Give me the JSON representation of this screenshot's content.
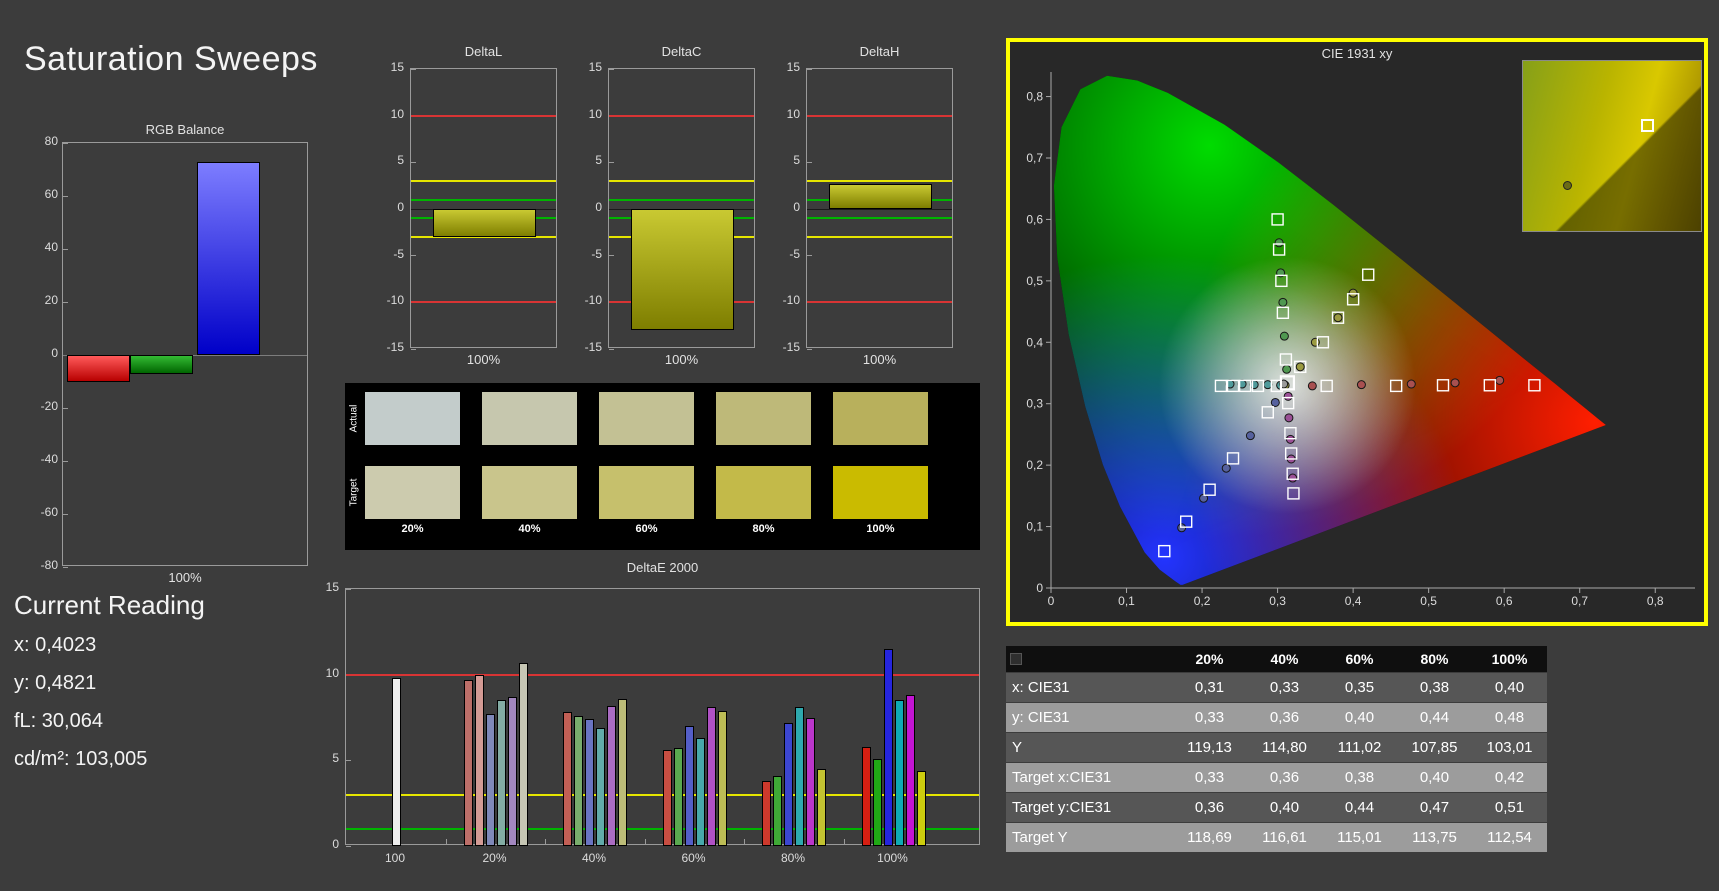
{
  "page": {
    "title": "Saturation Sweeps"
  },
  "current_reading": {
    "heading": "Current Reading",
    "x": "x: 0,4023",
    "y": "y: 0,4821",
    "fl": "fL: 30,064",
    "cdm2": "cd/m²: 103,005"
  },
  "rgb_balance": {
    "title": "RGB Balance",
    "x_label": "100%",
    "ylim": [
      -80,
      80
    ],
    "y_ticks": [
      "80",
      "60",
      "40",
      "20",
      "0",
      "-20",
      "-40",
      "-60",
      "-80"
    ],
    "bars": [
      {
        "name": "red",
        "value": -10,
        "grad": [
          "#ff5a5a",
          "#b80000"
        ]
      },
      {
        "name": "green",
        "value": -7,
        "grad": [
          "#33bb33",
          "#006600"
        ]
      },
      {
        "name": "blue",
        "value": 73,
        "grad": [
          "#7d7dff",
          "#0000c8"
        ]
      }
    ]
  },
  "delta_charts": {
    "ylim": [
      -15,
      15
    ],
    "y_ticks": [
      "15",
      "10",
      "5",
      "0",
      "-5",
      "-10",
      "-15"
    ],
    "bar_grad": [
      "#c9c932",
      "#7e7e00"
    ],
    "limits": [
      {
        "value": 10,
        "color": "#d83434"
      },
      {
        "value": -10,
        "color": "#d83434"
      },
      {
        "value": 3,
        "color": "#e6e600"
      },
      {
        "value": -3,
        "color": "#e6e600"
      },
      {
        "value": 1,
        "color": "#00b400"
      },
      {
        "value": -1,
        "color": "#00b400"
      }
    ],
    "charts": [
      {
        "title": "DeltaL",
        "x_label": "100%",
        "value": -3
      },
      {
        "title": "DeltaC",
        "x_label": "100%",
        "value": -13
      },
      {
        "title": "DeltaH",
        "x_label": "100%",
        "value": 2.7
      }
    ]
  },
  "swatches": {
    "row_labels": [
      "Actual",
      "Target"
    ],
    "col_labels": [
      "20%",
      "40%",
      "60%",
      "80%",
      "100%"
    ],
    "actual": [
      "#c3cccb",
      "#c6c7ae",
      "#c3c194",
      "#beb979",
      "#b8b05c"
    ],
    "target": [
      "#cccbae",
      "#c9c58c",
      "#c6c06c",
      "#c3ba49",
      "#cabb00"
    ]
  },
  "deltae": {
    "title": "DeltaE 2000",
    "ylim": [
      0,
      15
    ],
    "y_ticks": [
      "15",
      "10",
      "5",
      "0"
    ],
    "limits": [
      {
        "value": 10,
        "color": "#d83434"
      },
      {
        "value": 3,
        "color": "#e6e600"
      },
      {
        "value": 1,
        "color": "#00b400"
      }
    ],
    "groups": [
      {
        "label": "100",
        "bars": [
          {
            "v": 9.8,
            "c": "#ededed"
          }
        ]
      },
      {
        "label": "20%",
        "bars": [
          {
            "v": 9.7,
            "c": "#bd6f69"
          },
          {
            "v": 10.0,
            "c": "#d49b95"
          },
          {
            "v": 7.7,
            "c": "#7f88b9"
          },
          {
            "v": 8.5,
            "c": "#83aca4"
          },
          {
            "v": 8.7,
            "c": "#a287bf"
          },
          {
            "v": 10.7,
            "c": "#c6c6b4"
          }
        ]
      },
      {
        "label": "40%",
        "bars": [
          {
            "v": 7.8,
            "c": "#c25f55"
          },
          {
            "v": 7.6,
            "c": "#79ad6d"
          },
          {
            "v": 7.4,
            "c": "#6a74c2"
          },
          {
            "v": 6.9,
            "c": "#62abaa"
          },
          {
            "v": 8.2,
            "c": "#aa6cc2"
          },
          {
            "v": 8.6,
            "c": "#bcbc78"
          }
        ]
      },
      {
        "label": "60%",
        "bars": [
          {
            "v": 5.6,
            "c": "#c84e42"
          },
          {
            "v": 5.7,
            "c": "#5aa950"
          },
          {
            "v": 7.0,
            "c": "#545ec8"
          },
          {
            "v": 6.3,
            "c": "#48a9ab"
          },
          {
            "v": 8.1,
            "c": "#b051c5"
          },
          {
            "v": 7.9,
            "c": "#bcbc55"
          }
        ]
      },
      {
        "label": "80%",
        "bars": [
          {
            "v": 3.8,
            "c": "#cd392c"
          },
          {
            "v": 4.1,
            "c": "#3fa936"
          },
          {
            "v": 7.2,
            "c": "#3c46d0"
          },
          {
            "v": 8.1,
            "c": "#2ea9ae"
          },
          {
            "v": 7.5,
            "c": "#ba36ca"
          },
          {
            "v": 4.5,
            "c": "#c2c231"
          }
        ]
      },
      {
        "label": "100%",
        "bars": [
          {
            "v": 5.8,
            "c": "#d61f12"
          },
          {
            "v": 5.1,
            "c": "#20a915"
          },
          {
            "v": 11.5,
            "c": "#2525de"
          },
          {
            "v": 8.5,
            "c": "#0faab3"
          },
          {
            "v": 8.8,
            "c": "#c315d3"
          },
          {
            "v": 4.4,
            "c": "#cdcd0e"
          }
        ]
      }
    ]
  },
  "cie": {
    "title": "CIE 1931 xy",
    "x_ticks": [
      "0",
      "0,1",
      "0,2",
      "0,3",
      "0,4",
      "0,5",
      "0,6",
      "0,7",
      "0,8"
    ],
    "y_ticks": [
      "0",
      "0,1",
      "0,2",
      "0,3",
      "0,4",
      "0,5",
      "0,6",
      "0,7",
      "0,8"
    ],
    "border_color": "#ffff00",
    "white_dot": [
      0.308,
      0.332
    ],
    "selected_square": [
      0.313,
      0.334
    ],
    "sweeps": [
      {
        "name": "red",
        "dot_color": "#a85050",
        "targets": [
          [
            0.365,
            0.329
          ],
          [
            0.457,
            0.329
          ],
          [
            0.519,
            0.33
          ],
          [
            0.581,
            0.33
          ],
          [
            0.64,
            0.33
          ]
        ],
        "measured": [
          [
            0.346,
            0.329
          ],
          [
            0.411,
            0.331
          ],
          [
            0.477,
            0.332
          ],
          [
            0.535,
            0.334
          ],
          [
            0.594,
            0.338
          ]
        ]
      },
      {
        "name": "green",
        "dot_color": "#4f9850",
        "targets": [
          [
            0.311,
            0.372
          ],
          [
            0.307,
            0.448
          ],
          [
            0.305,
            0.5
          ],
          [
            0.302,
            0.551
          ],
          [
            0.3,
            0.6
          ]
        ],
        "measured": [
          [
            0.312,
            0.356
          ],
          [
            0.309,
            0.41
          ],
          [
            0.307,
            0.465
          ],
          [
            0.304,
            0.513
          ],
          [
            0.302,
            0.562
          ]
        ]
      },
      {
        "name": "blue",
        "dot_color": "#56619e",
        "targets": [
          [
            0.287,
            0.286
          ],
          [
            0.241,
            0.211
          ],
          [
            0.21,
            0.16
          ],
          [
            0.179,
            0.108
          ],
          [
            0.15,
            0.06
          ]
        ],
        "measured": [
          [
            0.297,
            0.302
          ],
          [
            0.264,
            0.248
          ],
          [
            0.232,
            0.195
          ],
          [
            0.202,
            0.146
          ],
          [
            0.173,
            0.098
          ]
        ]
      },
      {
        "name": "cyan",
        "dot_color": "#4f9a9a",
        "targets": [
          [
            0.299,
            0.329
          ],
          [
            0.274,
            0.329
          ],
          [
            0.257,
            0.329
          ],
          [
            0.241,
            0.329
          ],
          [
            0.225,
            0.329
          ]
        ],
        "measured": [
          [
            0.304,
            0.33
          ],
          [
            0.287,
            0.331
          ],
          [
            0.269,
            0.331
          ],
          [
            0.253,
            0.332
          ],
          [
            0.237,
            0.332
          ]
        ]
      },
      {
        "name": "magenta",
        "dot_color": "#9a5096",
        "targets": [
          [
            0.314,
            0.301
          ],
          [
            0.317,
            0.252
          ],
          [
            0.318,
            0.219
          ],
          [
            0.32,
            0.186
          ],
          [
            0.321,
            0.154
          ]
        ],
        "measured": [
          [
            0.314,
            0.312
          ],
          [
            0.315,
            0.277
          ],
          [
            0.317,
            0.242
          ],
          [
            0.318,
            0.21
          ],
          [
            0.32,
            0.179
          ]
        ]
      },
      {
        "name": "yellow",
        "dot_color": "#9a9a40",
        "targets": [
          [
            0.33,
            0.36
          ],
          [
            0.36,
            0.4
          ],
          [
            0.38,
            0.44
          ],
          [
            0.4,
            0.47
          ],
          [
            0.42,
            0.51
          ]
        ],
        "measured": [
          [
            0.31,
            0.33
          ],
          [
            0.33,
            0.36
          ],
          [
            0.35,
            0.4
          ],
          [
            0.38,
            0.44
          ],
          [
            0.4,
            0.48
          ]
        ]
      }
    ]
  },
  "table": {
    "col_headers": [
      "20%",
      "40%",
      "60%",
      "80%",
      "100%"
    ],
    "rows": [
      {
        "label": "x: CIE31",
        "values": [
          "0,31",
          "0,33",
          "0,35",
          "0,38",
          "0,40"
        ]
      },
      {
        "label": "y: CIE31",
        "values": [
          "0,33",
          "0,36",
          "0,40",
          "0,44",
          "0,48"
        ]
      },
      {
        "label": "Y",
        "values": [
          "119,13",
          "114,80",
          "111,02",
          "107,85",
          "103,01"
        ]
      },
      {
        "label": "Target x:CIE31",
        "values": [
          "0,33",
          "0,36",
          "0,38",
          "0,40",
          "0,42"
        ]
      },
      {
        "label": "Target y:CIE31",
        "values": [
          "0,36",
          "0,40",
          "0,44",
          "0,47",
          "0,51"
        ]
      },
      {
        "label": "Target Y",
        "values": [
          "118,69",
          "116,61",
          "115,01",
          "113,75",
          "112,54"
        ]
      }
    ]
  }
}
